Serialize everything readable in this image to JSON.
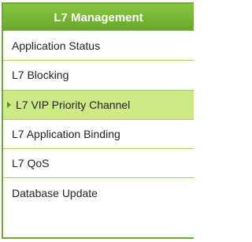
{
  "menu": {
    "title": "L7 Management",
    "items": [
      {
        "label": "Application Status"
      },
      {
        "label": "L7 Blocking"
      },
      {
        "label": "L7 VIP Priority Channel"
      },
      {
        "label": "L7 Application Binding"
      },
      {
        "label": "L7 QoS"
      },
      {
        "label": "Database Update"
      }
    ],
    "active_index": 2,
    "colors": {
      "header": "#72b232",
      "border": "#6ba936",
      "active_background": "#cdea84",
      "text": "#222222"
    },
    "icons": {
      "active_marker": "caret-right-icon"
    }
  }
}
